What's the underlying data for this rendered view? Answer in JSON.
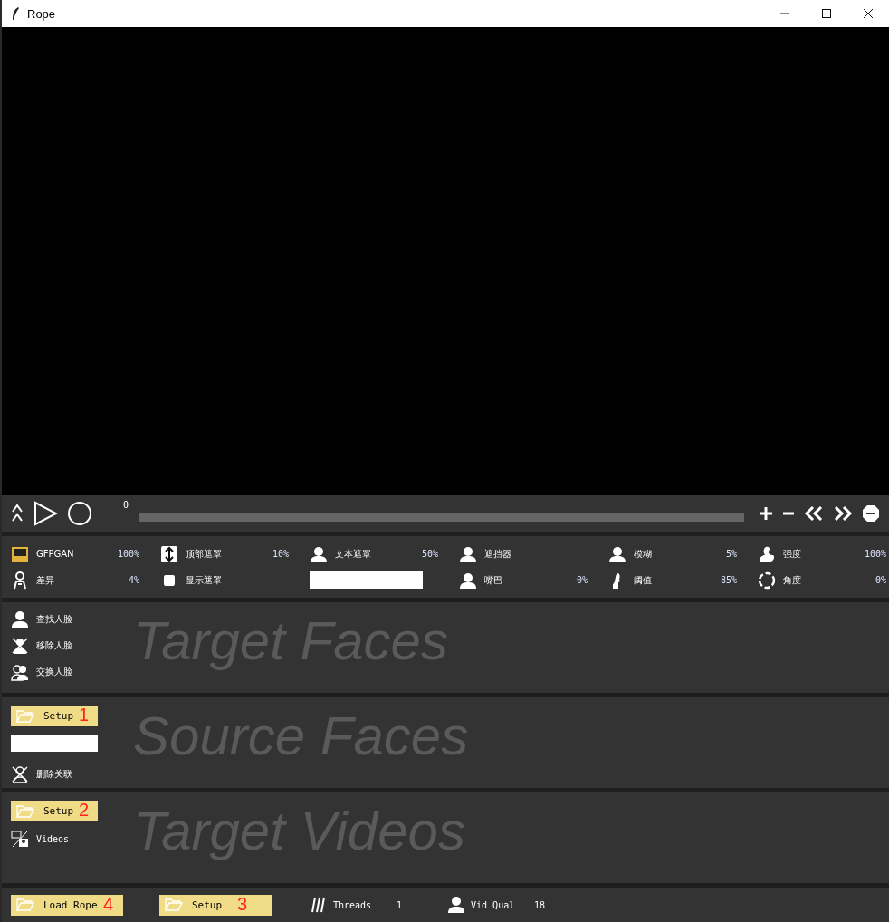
{
  "window": {
    "title": "Rope"
  },
  "transport": {
    "frame": "0",
    "level": 0
  },
  "parameters": [
    {
      "kind": "value",
      "label": "GFPGAN",
      "value": "100%"
    },
    {
      "kind": "value",
      "label": "顶部遮罩",
      "value": "10%"
    },
    {
      "kind": "value",
      "label": "文本遮罩",
      "value": "50%"
    },
    {
      "kind": "plain",
      "label": "遮挡器"
    },
    {
      "kind": "value",
      "label": "模糊",
      "value": "5%"
    },
    {
      "kind": "value",
      "label": "强度",
      "value": "100%"
    },
    {
      "kind": "value",
      "label": "差异",
      "value": "4%"
    },
    {
      "kind": "plain",
      "label": "显示遮罩"
    },
    {
      "kind": "field"
    },
    {
      "kind": "value",
      "label": "嘴巴",
      "value": "0%"
    },
    {
      "kind": "value",
      "label": "阈值",
      "value": "85%"
    },
    {
      "kind": "value",
      "label": "角度",
      "value": "0%"
    }
  ],
  "target_faces": {
    "title": "Target Faces",
    "actions": [
      "查找人脸",
      "移除人脸",
      "交换人脸"
    ]
  },
  "source_faces": {
    "title": "Source Faces",
    "setup_button": {
      "label": "Setup",
      "annotation": "1"
    },
    "actions": [
      "删除关联"
    ]
  },
  "target_videos": {
    "title": "Target Videos",
    "setup_button": {
      "label": "Setup",
      "annotation": "2"
    },
    "filter": "Videos"
  },
  "bottom_bar": {
    "load_button": {
      "label": "Load Rope",
      "annotation": "4"
    },
    "setup_button": {
      "label": "Setup",
      "annotation": "3"
    },
    "threads": {
      "label": "Threads",
      "value": "1"
    },
    "video_quality": {
      "label": "Vid Qual",
      "value": "18"
    }
  }
}
